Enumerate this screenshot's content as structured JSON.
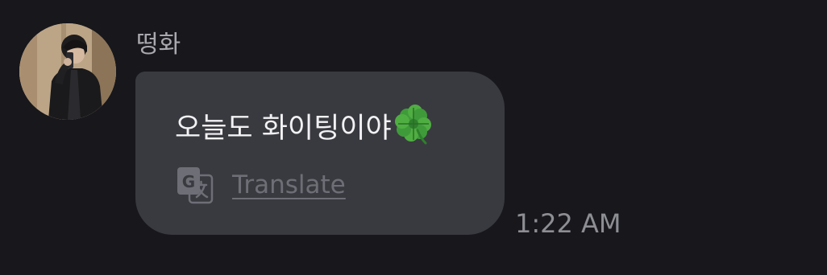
{
  "message": {
    "sender": {
      "name": "떵화",
      "avatar_icon": "profile-photo"
    },
    "text": "오늘도 화이팅이야",
    "emoji": "🍀",
    "translate_label": "Translate",
    "translate_icon": "google-translate-icon",
    "timestamp": "1:22 AM"
  },
  "colors": {
    "background": "#17171c",
    "bubble": "#393a40",
    "message_text": "#f2f2f4",
    "sender_name": "#a8a8ae",
    "translate": "#6e6f76",
    "timestamp": "#8d8e94"
  }
}
